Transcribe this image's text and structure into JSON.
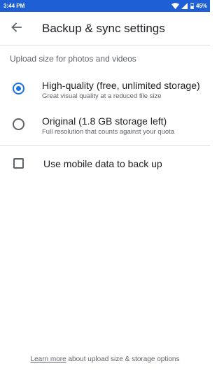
{
  "status_bar": {
    "time": "3:44 PM",
    "battery": "45%",
    "icons": [
      "wifi-icon",
      "signal-icon",
      "battery-icon"
    ],
    "background_color": "#1f5fd6"
  },
  "app_bar": {
    "back_icon": "arrow-back-icon",
    "title": "Backup & sync settings"
  },
  "upload_size": {
    "header": "Upload size for photos and videos",
    "selected_index": 0,
    "options": [
      {
        "title": "High-quality (free, unlimited storage)",
        "subtitle": "Great visual quality at a reduced file size",
        "selected": true
      },
      {
        "title": "Original (1.8 GB storage left)",
        "subtitle": "Full resolution that counts against your quota",
        "selected": false
      }
    ]
  },
  "mobile_data": {
    "label": "Use mobile data to back up",
    "checked": false
  },
  "footer": {
    "link_text": "Learn more",
    "text": " about upload size & storage options"
  },
  "colors": {
    "accent": "#1a73e8",
    "primary_text": "#202124",
    "secondary_text": "#5f6368"
  }
}
